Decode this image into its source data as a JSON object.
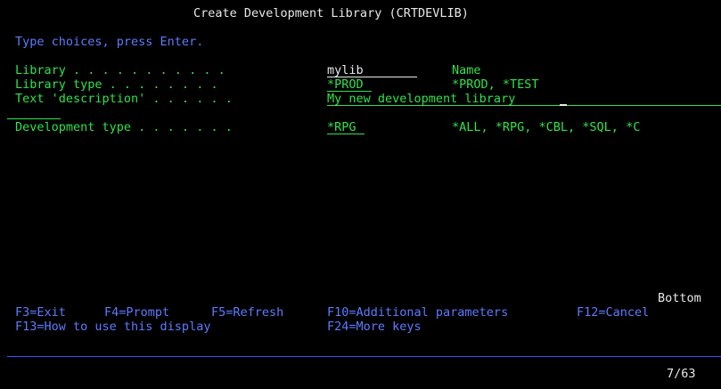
{
  "title": "Create Development Library (CRTDEVLIB)",
  "instructions": "Type choices, press Enter.",
  "fields": {
    "library": {
      "label": "Library . . . . . . . . . . .",
      "value": "mylib",
      "hint": "Name"
    },
    "library_type": {
      "label": "Library type . . . . . . . .",
      "value": "*PROD",
      "hint": "*PROD, *TEST"
    },
    "text_description": {
      "label": "Text 'description' . . . . . .",
      "value": "My new development library"
    },
    "development_type": {
      "label": "Development type . . . . . . .",
      "value": "*RPG",
      "hint": "*ALL, *RPG, *CBL, *SQL, *C"
    }
  },
  "more_indicator": "Bottom",
  "function_keys": {
    "row1": [
      {
        "key": "F3=Exit"
      },
      {
        "key": "F4=Prompt"
      },
      {
        "key": "F5=Refresh"
      },
      {
        "key": "F10=Additional parameters"
      },
      {
        "key": "F12=Cancel"
      }
    ],
    "row2": [
      {
        "key": "F13=How to use this display"
      },
      {
        "key": "F24=More keys"
      }
    ]
  },
  "status": {
    "cursor_position": "7/63"
  }
}
